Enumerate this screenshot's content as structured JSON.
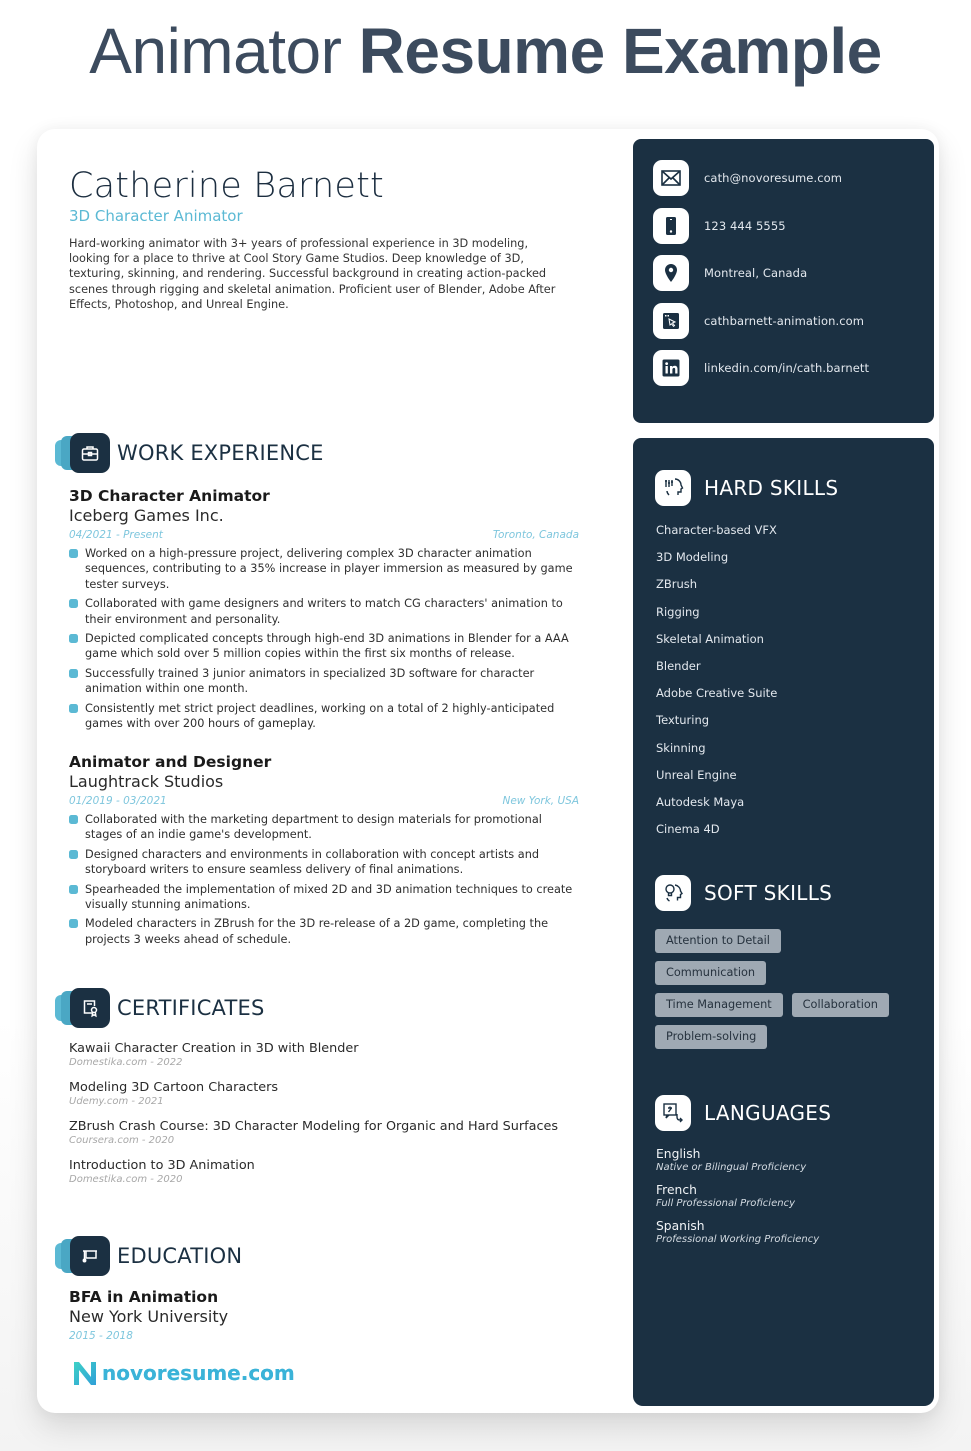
{
  "page_title": {
    "light": "Animator",
    "bold": "Resume Example"
  },
  "resume": {
    "name": "Catherine Barnett",
    "role": "3D Character Animator",
    "summary": "Hard-working animator with 3+ years of professional experience in 3D modeling, looking for a place to thrive at Cool Story Game Studios. Deep knowledge of 3D, texturing, skinning, and rendering. Successful background in creating action-packed scenes through rigging and skeletal animation. Proficient user of Blender, Adobe After Effects, Photoshop, and Unreal Engine.",
    "colors": {
      "accent": "#5bb9d4",
      "navy": "#1b3042",
      "chip": "#9fa9b3"
    }
  },
  "contact": {
    "items": [
      {
        "icon": "envelope-icon",
        "text": "cath@novoresume.com"
      },
      {
        "icon": "phone-icon",
        "text": "123 444 5555"
      },
      {
        "icon": "map-pin-icon",
        "text": "Montreal, Canada"
      },
      {
        "icon": "browser-cursor-icon",
        "text": "cathbarnett-animation.com"
      },
      {
        "icon": "linkedin-icon",
        "text": "linkedin.com/in/cath.barnett"
      }
    ]
  },
  "work": {
    "title": "WORK EXPERIENCE",
    "icon": "briefcase-icon",
    "jobs": [
      {
        "title": "3D Character Animator",
        "company": "Iceberg Games Inc.",
        "dates": "04/2021 - Present",
        "location": "Toronto, Canada",
        "bullets": [
          "Worked on a high-pressure project, delivering complex 3D character animation sequences, contributing to a 35% increase in player immersion as measured by game tester surveys.",
          "Collaborated with game designers and writers to match CG characters' animation to their environment and personality.",
          "Depicted complicated concepts through high-end 3D animations in Blender for a AAA game which sold over 5 million copies within the first six months of release.",
          "Successfully trained 3 junior animators in specialized 3D software for character animation within one month.",
          "Consistently met strict project deadlines, working on a total of 2 highly-anticipated games with over 200 hours of gameplay."
        ]
      },
      {
        "title": "Animator and Designer",
        "company": "Laughtrack Studios",
        "dates": "01/2019 - 03/2021",
        "location": "New York, USA",
        "bullets": [
          "Collaborated with the marketing department to design materials for promotional stages of an indie game's development.",
          "Designed characters and environments in collaboration with concept artists and storyboard writers to ensure seamless delivery of final animations.",
          "Spearheaded the implementation of mixed 2D and 3D animation techniques to create visually stunning animations.",
          "Modeled characters in ZBrush for the 3D re-release of a 2D game, completing the projects 3 weeks ahead of schedule."
        ]
      }
    ]
  },
  "certificates": {
    "title": "CERTIFICATES",
    "icon": "certificate-icon",
    "items": [
      {
        "name": "Kawaii Character Creation in 3D with Blender",
        "source": "Domestika.com - 2022"
      },
      {
        "name": "Modeling 3D Cartoon Characters",
        "source": "Udemy.com - 2021"
      },
      {
        "name": "ZBrush Crash Course: 3D Character Modeling for Organic and Hard Surfaces",
        "source": "Coursera.com - 2020"
      },
      {
        "name": "Introduction to 3D Animation",
        "source": "Domestika.com - 2020"
      }
    ]
  },
  "education": {
    "title": "EDUCATION",
    "icon": "graduation-cap-icon",
    "degree": "BFA in Animation",
    "school": "New York University",
    "dates": "2015 - 2018"
  },
  "hard_skills": {
    "title": "HARD SKILLS",
    "icon": "head-gears-icon",
    "items": [
      "Character-based VFX",
      "3D Modeling",
      "ZBrush",
      "Rigging",
      "Skeletal Animation",
      "Blender",
      "Adobe Creative Suite",
      "Texturing",
      "Skinning",
      "Unreal Engine",
      "Autodesk Maya",
      "Cinema 4D"
    ]
  },
  "soft_skills": {
    "title": "SOFT SKILLS",
    "icon": "lightbulb-head-icon",
    "items": [
      "Attention to Detail",
      "Communication",
      "Time Management",
      "Collaboration",
      "Problem-solving"
    ]
  },
  "languages": {
    "title": "LANGUAGES",
    "icon": "translate-icon",
    "items": [
      {
        "name": "English",
        "level": "Native or Bilingual Proficiency"
      },
      {
        "name": "French",
        "level": "Full Professional Proficiency"
      },
      {
        "name": "Spanish",
        "level": "Professional Working Proficiency"
      }
    ]
  },
  "brand": {
    "wordmark": "novoresume.com"
  }
}
